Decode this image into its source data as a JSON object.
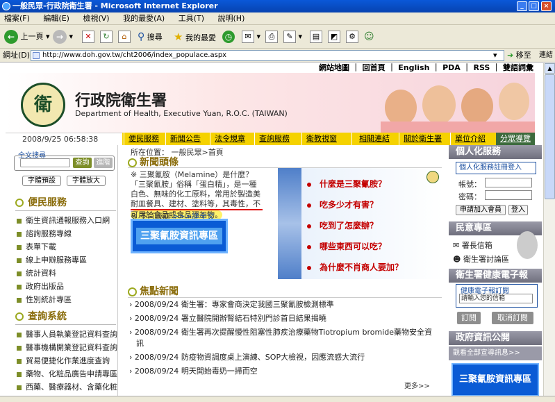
{
  "window": {
    "title": "一般民眾-行政院衛生署 - Microsoft Internet Explorer",
    "controls": [
      "_",
      "□",
      "×"
    ]
  },
  "menu": [
    "檔案(F)",
    "編輯(E)",
    "檢視(V)",
    "我的最愛(A)",
    "工具(T)",
    "說明(H)"
  ],
  "toolbar": {
    "back_label": "上一頁",
    "search_label": "搜尋",
    "favorites_label": "我的最愛"
  },
  "address": {
    "label": "網址(D)",
    "url": "http://www.doh.gov.tw/cht2006/index_populace.aspx",
    "go_label": "移至",
    "links_label": "連結"
  },
  "site": {
    "topnav": [
      "網站地圖",
      "回首頁",
      "English",
      "PDA",
      "RSS",
      "雙語詞彙"
    ],
    "org_cn": "行政院衛生署",
    "org_en": "Department of Health, Executive Yuan, R.O.C. (TAIWAN)",
    "emblem_glyph": "衛",
    "datetime": "2008/9/25 06:58:38",
    "nav": [
      "便民服務",
      "新聞公告",
      "法令規章",
      "查詢服務",
      "衛教視窗",
      "相關連結",
      "關於衛生署",
      "單位介紹"
    ],
    "guide": "分眾導覽",
    "accent_yellow": "#f5d200",
    "accent_green": "#7d8e28"
  },
  "left": {
    "search_title": "全文搜尋",
    "search_btn": "查詢",
    "advanced_btn": "進階",
    "font_default": "字體預設",
    "font_large": "字體放大",
    "service_head": "便民服務",
    "service_items": [
      "衛生資訊通報服務入口網",
      "諮詢服務專線",
      "表單下載",
      "線上申辦服務專區",
      "統計資料",
      "政府出版品",
      "性別統計專區"
    ],
    "query_head": "查詢系統",
    "query_items": [
      "醫事人員執業登記資料查詢",
      "醫事機構開業登記資料查詢",
      "貿易便捷化作業進度查詢",
      "藥物、化粧品廣告申請專區",
      "西藥、醫療器材、含藥化粧"
    ]
  },
  "center": {
    "breadcrumb": "所在位置： 一般民眾>首頁",
    "headline_title": "新聞頭條",
    "headline_lines": [
      "※ 三聚氰胺（Melamine）是什麼？",
      "「三聚氰胺」俗稱「蛋白精」，是一種",
      "白色、無味的化工原料，常用於製造美",
      "耐皿餐具、建材、塗料等，其毒性，不",
      "可用於食品或食品添加物。"
    ],
    "notice_prefix": "※ 不肖廠商",
    "notice_link": ">>>詳全文",
    "info_button": "三聚氰胺資訊專區",
    "faq_items": [
      "什麼是三聚氰胺？",
      "吃多少才有害？",
      "吃到了怎麼辦？",
      "哪些東西可以吃？",
      "為什麼不肖商人要加？"
    ],
    "focus_title": "焦點新聞",
    "news": [
      {
        "date": "2008/09/24",
        "text": "衛生署：專家會商決定我國三聚氰胺檢測標準"
      },
      {
        "date": "2008/09/24",
        "text": "署立醫院開辦腎結石特別門診首日結果揭曉"
      },
      {
        "date": "2008/09/24",
        "text": "衛生署再次提醒慢性阻塞性肺疾治療藥物Tiotropium bromide藥物安全資"
      },
      {
        "date": "",
        "text": "訊"
      },
      {
        "date": "2008/09/24",
        "text": "防疫物資調度桌上演練、SOP大檢視，因應流感大流行"
      },
      {
        "date": "2008/09/24",
        "text": "明天開始毒奶一掃而空"
      }
    ],
    "more": "更多>>"
  },
  "right": {
    "personal_head": "個人化服務",
    "login_title": "個人化服務註冊登入",
    "account_label": "帳號：",
    "password_label": "密碼：",
    "join_btn": "申請加入會員",
    "login_btn": "登入",
    "opinion_head": "民意專區",
    "mailbox": "署長信箱",
    "forum": "衛生署討論區",
    "epaper_head": "衛生署健康電子報",
    "epaper_title": "健康電子報訂閱",
    "epaper_placeholder": "請輸入您的信箱",
    "subscribe_btn": "訂閱",
    "unsubscribe_btn": "取消訂閱",
    "gov_head": "政府資訊公開",
    "promo_link": "觀看全部宣導訊息>>",
    "promo_button": "三聚氰胺資訊專區"
  }
}
